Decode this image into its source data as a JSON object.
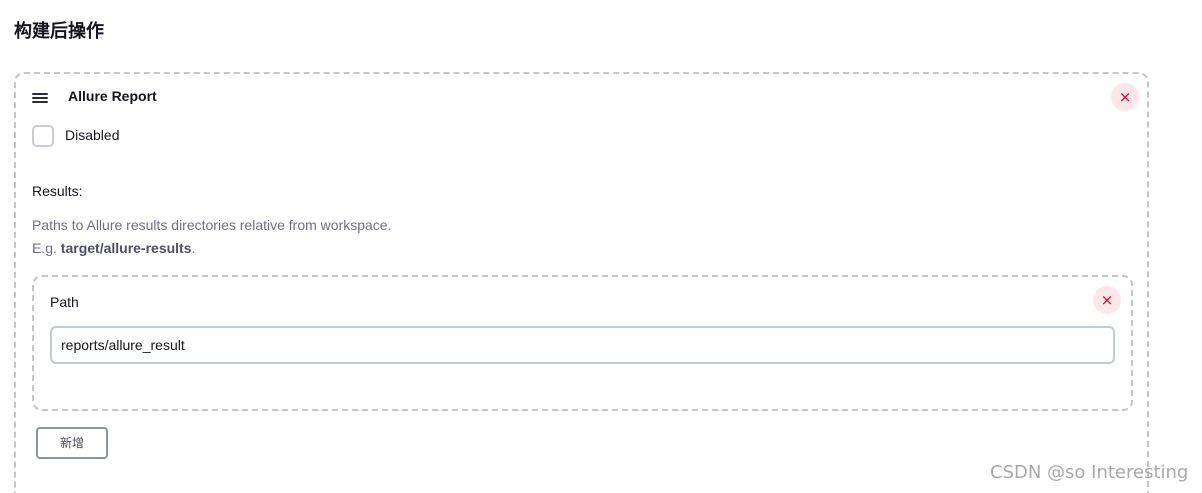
{
  "section": {
    "title": "构建后操作"
  },
  "step": {
    "title": "Allure Report",
    "close_glyph": "×",
    "disabled_label": "Disabled",
    "disabled_checked": false
  },
  "results": {
    "label": "Results:",
    "help_line1": "Paths to Allure results directories relative from workspace.",
    "help_line2_prefix": "E.g. ",
    "help_line2_example": "target/allure-results",
    "help_line2_suffix": "."
  },
  "path_entry": {
    "label": "Path",
    "value": "reports/allure_result",
    "close_glyph": "×"
  },
  "add_button": {
    "label": "新增"
  },
  "watermark": {
    "text": "CSDN @so  Interesting"
  },
  "colors": {
    "close_bg": "#fde7ea",
    "close_fg": "#e6001f",
    "dashed_border": "#c3c7cc",
    "help_text": "#6e6e8a"
  }
}
